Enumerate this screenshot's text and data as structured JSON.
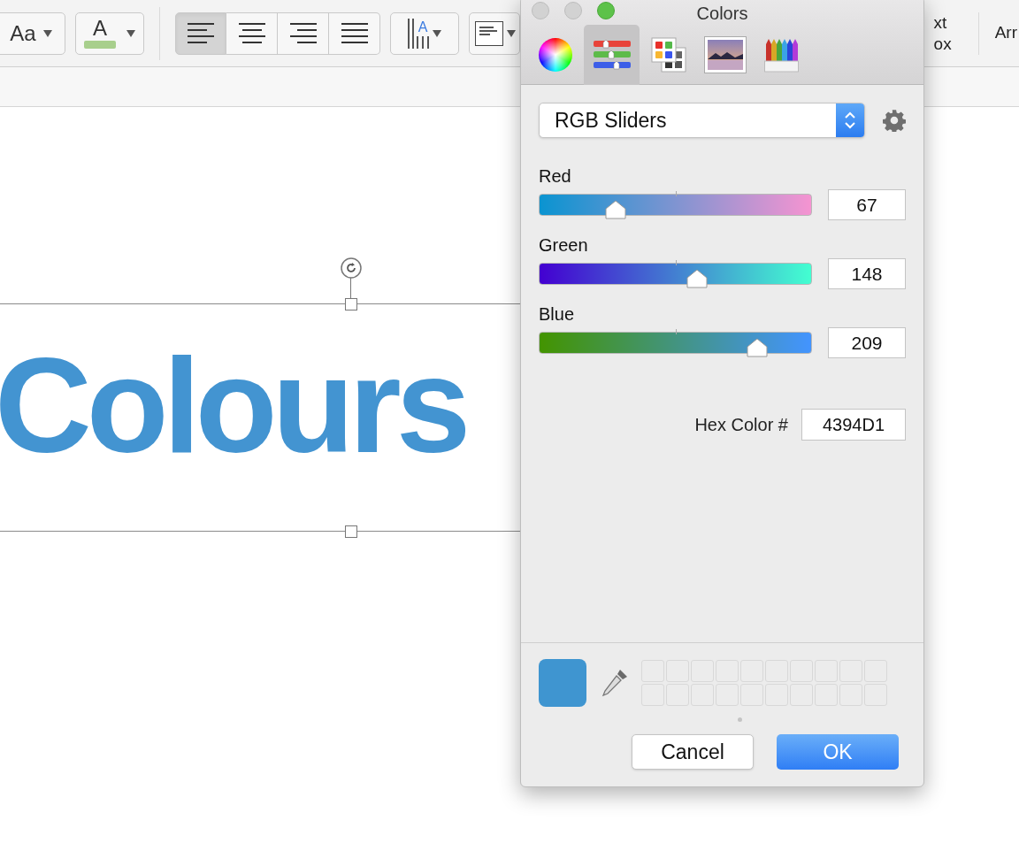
{
  "toolbar": {
    "change_case": {
      "label": "Aa"
    },
    "font_color": {
      "label": "A"
    },
    "alignment": [
      {
        "kind": "left",
        "selected": true
      },
      {
        "kind": "center",
        "selected": false
      },
      {
        "kind": "right",
        "selected": false
      },
      {
        "kind": "justify",
        "selected": false
      }
    ],
    "line_spacing": {
      "label": "A"
    },
    "text_box": {
      "label_lines": [
        "xt",
        "ox"
      ]
    },
    "arrange": {
      "label": "Arr"
    }
  },
  "document": {
    "text": "Colours"
  },
  "colors_window": {
    "title": "Colors",
    "tabs": [
      {
        "kind": "wheel",
        "selected": false
      },
      {
        "kind": "sliders",
        "selected": true
      },
      {
        "kind": "palettes",
        "selected": false
      },
      {
        "kind": "image",
        "selected": false
      },
      {
        "kind": "pencils",
        "selected": false
      }
    ],
    "mode": "RGB Sliders",
    "sliders": [
      {
        "label": "Red",
        "level": 0.28,
        "value": "67"
      },
      {
        "label": "Green",
        "level": 0.58,
        "value": "148"
      },
      {
        "label": "Blue",
        "level": 0.8,
        "value": "209"
      }
    ],
    "hex_label": "Hex Color #",
    "hex_value": "4394D1",
    "current_swatch": {
      "color": "#3f95d0"
    },
    "buttons": [
      {
        "label": "Cancel",
        "kind": "default"
      },
      {
        "label": "OK",
        "kind": "primary"
      }
    ]
  }
}
